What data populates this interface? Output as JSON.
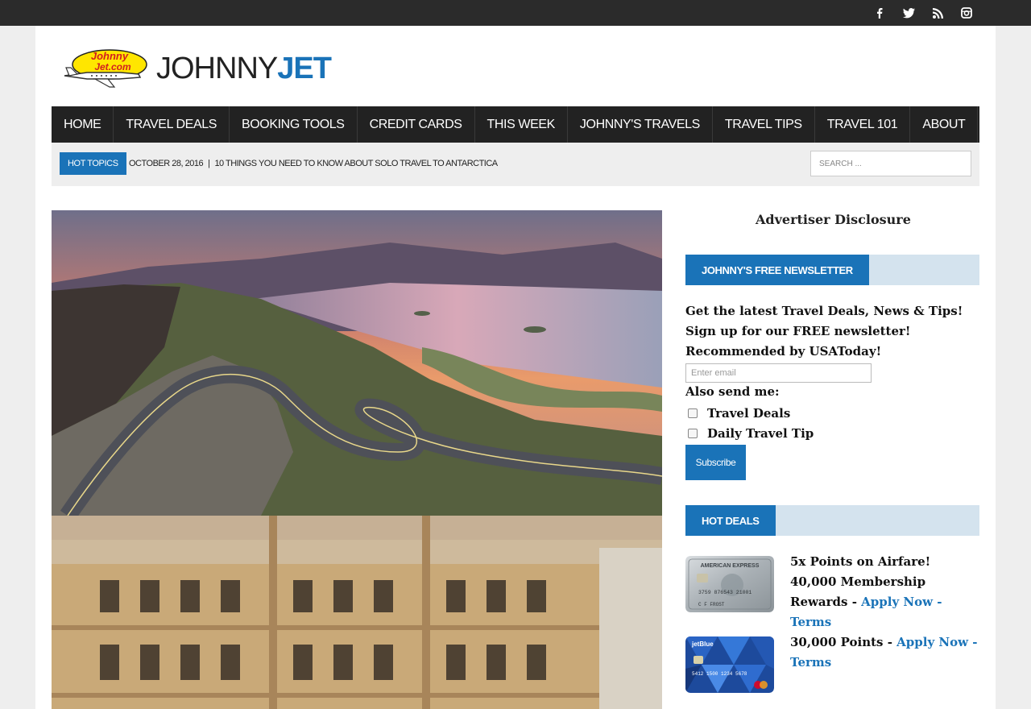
{
  "social": {
    "facebook_icon": "f",
    "twitter_icon": "t",
    "rss_icon": "rss",
    "instagram_icon": "ig"
  },
  "logo": {
    "badge_text": "Johnny Jet.com",
    "word_part1": "JOHNNY",
    "word_part2": "JET"
  },
  "nav": {
    "items": [
      "Home",
      "Travel Deals",
      "Booking Tools",
      "Credit Cards",
      "This Week",
      "Johnny's Travels",
      "Travel Tips",
      "Travel 101",
      "About"
    ]
  },
  "hot_topics": {
    "label": "Hot Topics",
    "date": "October 28, 2016",
    "separator": "|",
    "headline": "10 Things You Need to Know About Solo Travel to Antarctica"
  },
  "search": {
    "placeholder": "SEARCH ..."
  },
  "sidebar": {
    "advertiser_disclosure": "Advertiser Disclosure",
    "newsletter_title": "Johnny's Free Newsletter",
    "newsletter_text": "Get the latest Travel Deals, News & Tips! Sign up for our FREE newsletter! Recommended by USAToday!",
    "email_placeholder": "Enter email",
    "also_send": "Also send me:",
    "options": [
      "Travel Deals",
      "Daily Travel Tip"
    ],
    "subscribe_label": "Subscribe",
    "hot_deals_title": "Hot Deals",
    "deals": [
      {
        "card_name": "AMERICAN EXPRESS",
        "card_number": "3759 876543 21001",
        "card_holder": "C F FROST",
        "text": "5x Points on Airfare! 40,000 Membership Rewards - ",
        "link1": "Apply Now",
        "link_sep": " - ",
        "link2": "Terms"
      },
      {
        "card_name": "jetBlue",
        "card_number": "5412 1500 1234 5678",
        "text": "30,000 Points - ",
        "link1": "Apply Now",
        "link_sep": " - ",
        "link2": "Terms"
      }
    ]
  },
  "colors": {
    "accent": "#1a73b8",
    "nav_bg": "#222222",
    "topbar_bg": "#2b2b2b",
    "widget_bar": "#d4e3ee"
  }
}
